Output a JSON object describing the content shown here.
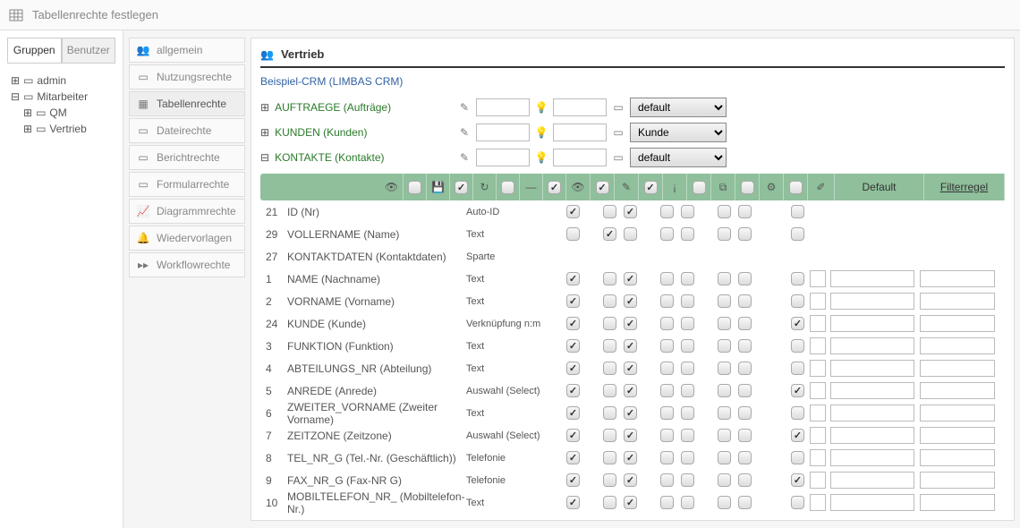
{
  "titlebar": {
    "title": "Tabellenrechte festlegen"
  },
  "left_tabs": {
    "groups": "Gruppen",
    "users": "Benutzer"
  },
  "tree": {
    "admin": "admin",
    "mitarbeiter": "Mitarbeiter",
    "qm": "QM",
    "vertrieb": "Vertrieb"
  },
  "nav": {
    "allgemein": "allgemein",
    "nutzungsrechte": "Nutzungsrechte",
    "tabellenrechte": "Tabellenrechte",
    "dateirechte": "Dateirechte",
    "berichtrechte": "Berichtrechte",
    "formularrechte": "Formularrechte",
    "diagrammrechte": "Diagrammrechte",
    "wiedervorlagen": "Wiedervorlagen",
    "workflowrechte": "Workflowrechte"
  },
  "main": {
    "group_name": "Vertrieb",
    "breadcrumb": "Beispiel-CRM (LIMBAS CRM)"
  },
  "entities": [
    {
      "label": "AUFTRAEGE (Aufträge)",
      "select": "default",
      "expanded": false
    },
    {
      "label": "KUNDEN (Kunden)",
      "select": "Kunde",
      "expanded": false
    },
    {
      "label": "KONTAKTE (Kontakte)",
      "select": "default",
      "expanded": true
    }
  ],
  "headers": {
    "default": "Default",
    "filterregel": "Filterregel"
  },
  "rows": [
    {
      "id": "21",
      "name": "ID (Nr)",
      "type": "Auto-ID",
      "c1": true,
      "c2": false,
      "c3": true,
      "c4": false,
      "c5": false,
      "c6": false,
      "c7": false,
      "c8": false,
      "has89": false
    },
    {
      "id": "29",
      "name": "VOLLERNAME (Name)",
      "type": "Text",
      "c1": false,
      "c2": true,
      "c3": false,
      "c4": false,
      "c5": false,
      "c6": false,
      "c7": false,
      "c8": false,
      "has89": false
    },
    {
      "id": "27",
      "name": "KONTAKTDATEN (Kontaktdaten)",
      "type": "Sparte",
      "c1": false,
      "c2": false,
      "c3": false,
      "c4": false,
      "c5": false,
      "c6": false,
      "c7": false,
      "c8": false,
      "has89": false
    },
    {
      "id": "1",
      "name": "NAME (Nachname)",
      "type": "Text",
      "c1": true,
      "c2": false,
      "c3": true,
      "c4": false,
      "c5": false,
      "c6": false,
      "c7": false,
      "c8": false,
      "has89": true
    },
    {
      "id": "2",
      "name": "VORNAME (Vorname)",
      "type": "Text",
      "c1": true,
      "c2": false,
      "c3": true,
      "c4": false,
      "c5": false,
      "c6": false,
      "c7": false,
      "c8": false,
      "has89": true
    },
    {
      "id": "24",
      "name": "KUNDE (Kunde)",
      "type": "Verknüpfung n:m",
      "c1": true,
      "c2": false,
      "c3": true,
      "c4": false,
      "c5": false,
      "c6": false,
      "c7": false,
      "c8": true,
      "has89": true
    },
    {
      "id": "3",
      "name": "FUNKTION (Funktion)",
      "type": "Text",
      "c1": true,
      "c2": false,
      "c3": true,
      "c4": false,
      "c5": false,
      "c6": false,
      "c7": false,
      "c8": false,
      "has89": true
    },
    {
      "id": "4",
      "name": "ABTEILUNGS_NR (Abteilung)",
      "type": "Text",
      "c1": true,
      "c2": false,
      "c3": true,
      "c4": false,
      "c5": false,
      "c6": false,
      "c7": false,
      "c8": false,
      "has89": true
    },
    {
      "id": "5",
      "name": "ANREDE (Anrede)",
      "type": "Auswahl (Select)",
      "c1": true,
      "c2": false,
      "c3": true,
      "c4": false,
      "c5": false,
      "c6": false,
      "c7": false,
      "c8": true,
      "has89": true
    },
    {
      "id": "6",
      "name": "ZWEITER_VORNAME (Zweiter Vorname)",
      "type": "Text",
      "c1": true,
      "c2": false,
      "c3": true,
      "c4": false,
      "c5": false,
      "c6": false,
      "c7": false,
      "c8": false,
      "has89": true
    },
    {
      "id": "7",
      "name": "ZEITZONE (Zeitzone)",
      "type": "Auswahl (Select)",
      "c1": true,
      "c2": false,
      "c3": true,
      "c4": false,
      "c5": false,
      "c6": false,
      "c7": false,
      "c8": true,
      "has89": true
    },
    {
      "id": "8",
      "name": "TEL_NR_G (Tel.-Nr. (Geschäftlich))",
      "type": "Telefonie",
      "c1": true,
      "c2": false,
      "c3": true,
      "c4": false,
      "c5": false,
      "c6": false,
      "c7": false,
      "c8": false,
      "has89": true
    },
    {
      "id": "9",
      "name": "FAX_NR_G (Fax-NR G)",
      "type": "Telefonie",
      "c1": true,
      "c2": false,
      "c3": true,
      "c4": false,
      "c5": false,
      "c6": false,
      "c7": false,
      "c8": true,
      "has89": true
    },
    {
      "id": "10",
      "name": "MOBILTELEFON_NR_ (Mobiltelefon-Nr.)",
      "type": "Text",
      "c1": true,
      "c2": false,
      "c3": true,
      "c4": false,
      "c5": false,
      "c6": false,
      "c7": false,
      "c8": false,
      "has89": true
    }
  ]
}
